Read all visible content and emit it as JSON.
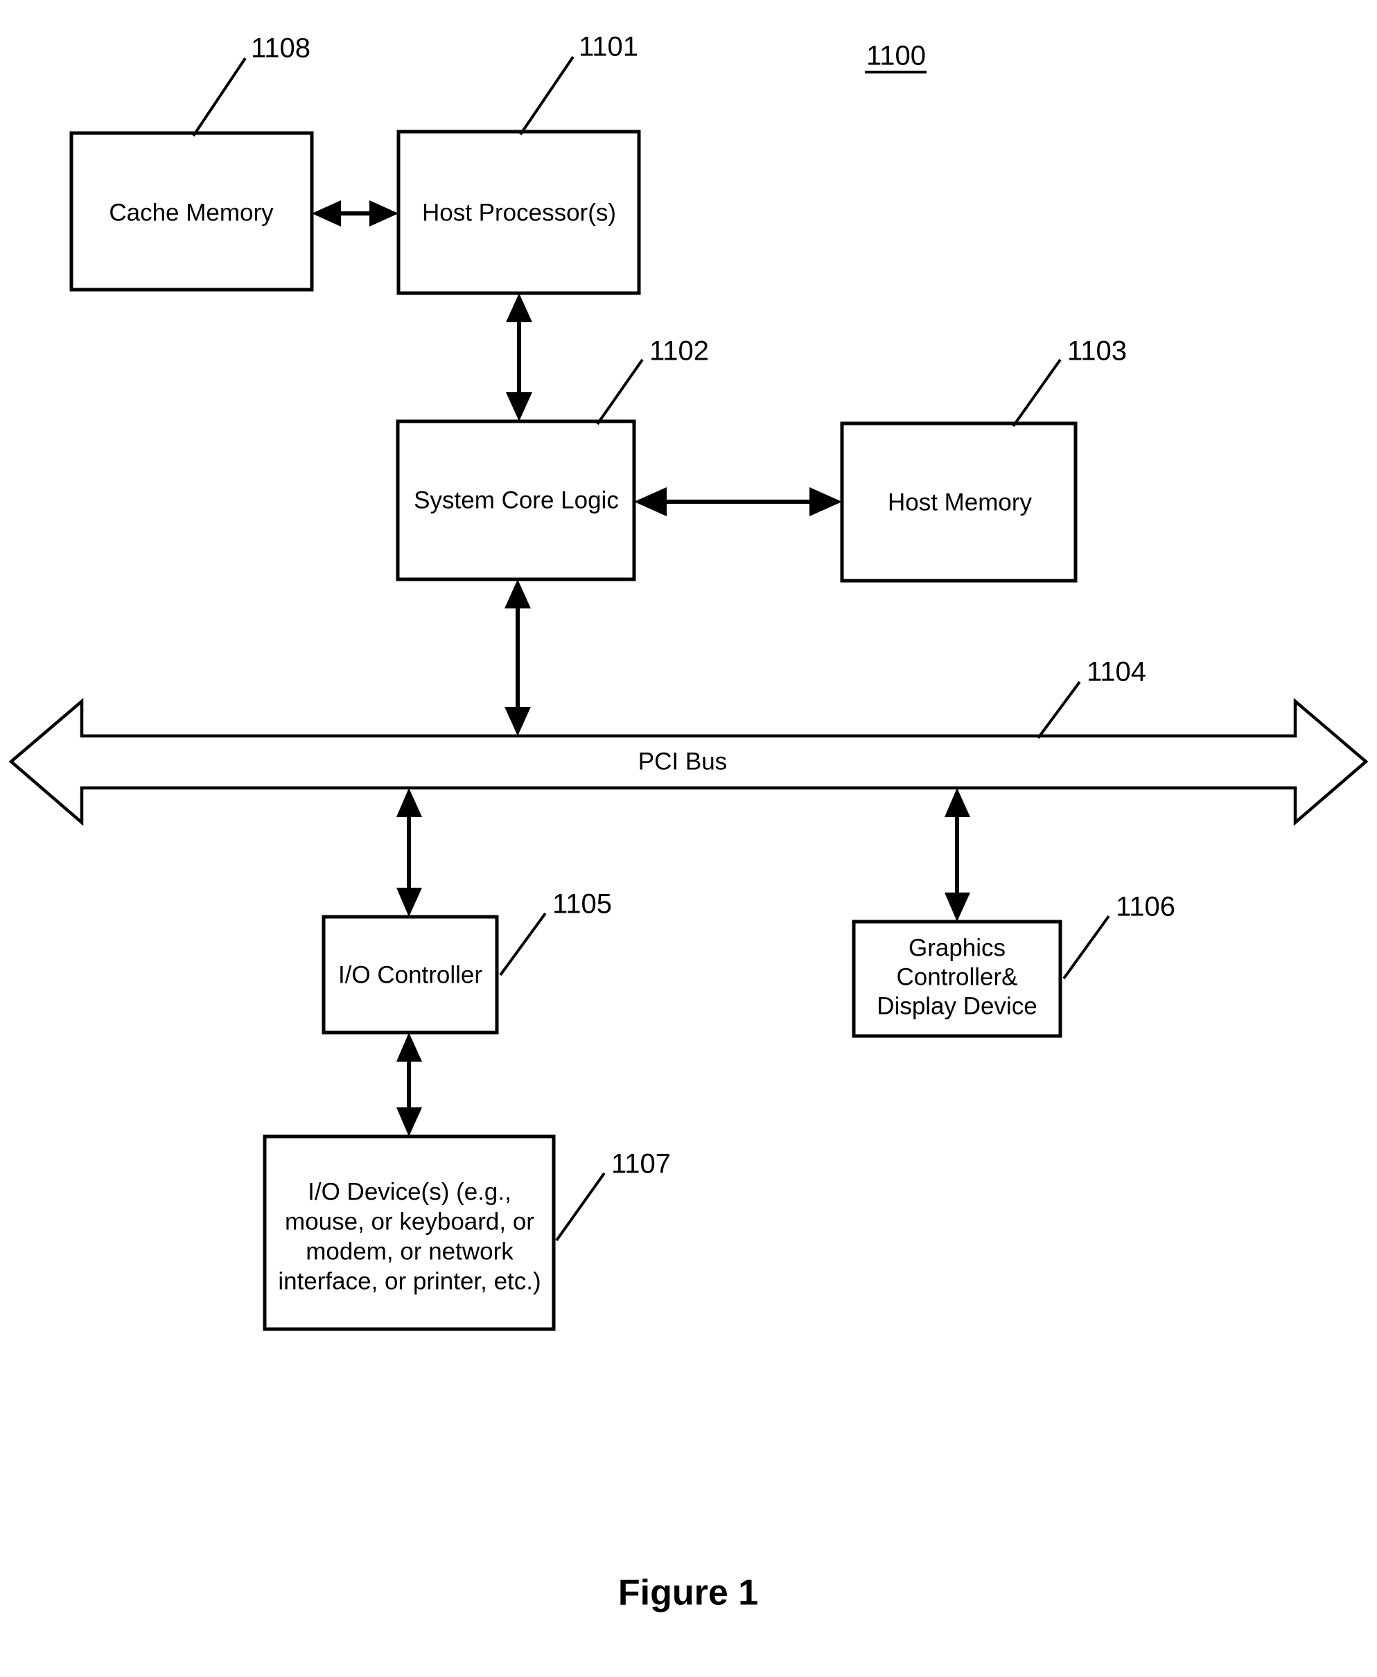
{
  "figure": {
    "system_number": "1100",
    "caption": "Figure 1",
    "bus_label": "PCI Bus"
  },
  "blocks": [
    {
      "id": "cache-memory",
      "ref": "1108",
      "lines": [
        "Cache Memory"
      ]
    },
    {
      "id": "host-processor",
      "ref": "1101",
      "lines": [
        "Host Processor(s)"
      ]
    },
    {
      "id": "system-core-logic",
      "ref": "1102",
      "lines": [
        "System Core Logic"
      ]
    },
    {
      "id": "host-memory",
      "ref": "1103",
      "lines": [
        "Host Memory"
      ]
    },
    {
      "id": "pci-bus",
      "ref": "1104",
      "lines": [
        "PCI Bus"
      ]
    },
    {
      "id": "io-controller",
      "ref": "1105",
      "lines": [
        "I/O Controller"
      ]
    },
    {
      "id": "graphics-controller",
      "ref": "1106",
      "lines": [
        "Graphics",
        "Controller&",
        "Display Device"
      ]
    },
    {
      "id": "io-devices",
      "ref": "1107",
      "lines": [
        "I/O Device(s) (e.g.,",
        "mouse, or keyboard, or",
        "modem, or network",
        "interface, or printer, etc.)"
      ]
    }
  ],
  "labels": {
    "cache_memory": "Cache Memory",
    "host_processor": "Host Processor(s)",
    "system_core_logic": "System Core Logic",
    "host_memory": "Host Memory",
    "io_controller": "I/O Controller",
    "graphics_line1": "Graphics",
    "graphics_line2": "Controller&",
    "graphics_line3": "Display Device",
    "io_devices_line1": "I/O Device(s) (e.g.,",
    "io_devices_line2": "mouse, or keyboard, or",
    "io_devices_line3": "modem, or network",
    "io_devices_line4": "interface, or printer, etc.)"
  },
  "refs": {
    "cache_memory": "1108",
    "host_processor": "1101",
    "system_core_logic": "1102",
    "host_memory": "1103",
    "pci_bus": "1104",
    "io_controller": "1105",
    "graphics_controller": "1106",
    "io_devices": "1107",
    "system": "1100"
  },
  "colors": {
    "stroke": "#000000",
    "fill": "#ffffff",
    "background": "#ffffff"
  }
}
